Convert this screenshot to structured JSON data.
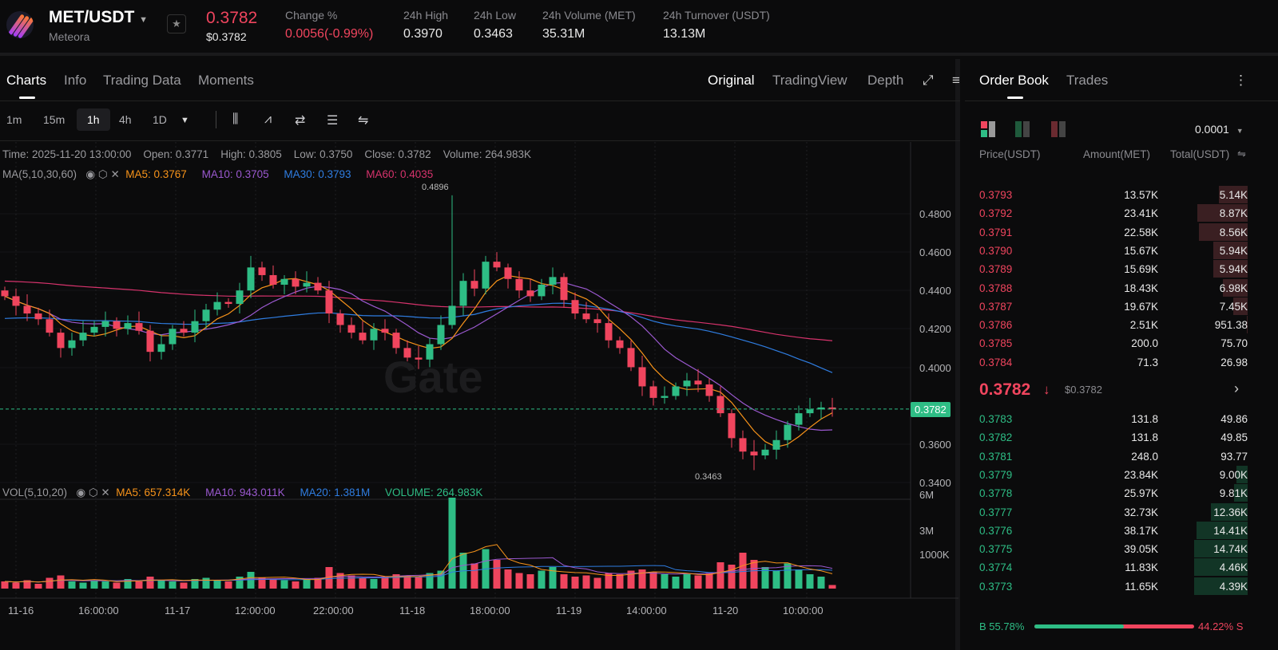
{
  "header": {
    "pair": "MET/USDT",
    "name": "Meteora",
    "price": "0.3782",
    "price_usd": "$0.3782",
    "stats": [
      {
        "label": "Change %",
        "value": "0.0056(-0.99%)"
      },
      {
        "label": "24h High",
        "value": "0.3970"
      },
      {
        "label": "24h Low",
        "value": "0.3463"
      },
      {
        "label": "24h Volume (MET)",
        "value": "35.31M"
      },
      {
        "label": "24h Turnover (USDT)",
        "value": "13.13M"
      }
    ]
  },
  "tabs": [
    "Charts",
    "Info",
    "Trading Data",
    "Moments"
  ],
  "views": [
    "Original",
    "TradingView",
    "Depth"
  ],
  "timeframes": [
    "1m",
    "15m",
    "1h",
    "4h",
    "1D"
  ],
  "ohlc": {
    "time": "Time: 2025-11-20 13:00:00",
    "open": "Open: 0.3771",
    "high": "High: 0.3805",
    "low": "Low: 0.3750",
    "close": "Close: 0.3782",
    "volume": "Volume: 264.983K"
  },
  "ma": {
    "label": "MA(5,10,30,60)",
    "ma5": "MA5: 0.3767",
    "ma10": "MA10: 0.3705",
    "ma30": "MA30: 0.3793",
    "ma60": "MA60: 0.4035"
  },
  "vol": {
    "label": "VOL(5,10,20)",
    "ma5": "MA5: 657.314K",
    "ma10": "MA10: 943.011K",
    "ma20": "MA20: 1.381M",
    "volume": "VOLUME: 264.983K"
  },
  "watermark": "Gate",
  "price_axis": [
    "0.4800",
    "0.4600",
    "0.4400",
    "0.4200",
    "0.4000",
    "0.3600",
    "0.3400"
  ],
  "vol_axis": [
    "6M",
    "3M",
    "1000K"
  ],
  "time_axis": [
    "11-16",
    "16:00:00",
    "11-17",
    "12:00:00",
    "22:00:00",
    "11-18",
    "18:00:00",
    "11-19",
    "14:00:00",
    "11-20",
    "10:00:00"
  ],
  "current_price_tag": "0.3782",
  "high_marker": "0.4896",
  "low_marker": "0.3463",
  "colors": {
    "up": "#2ebd85",
    "down": "#f0455e",
    "ma5": "#f7931a",
    "ma10": "#9b59d0",
    "ma30": "#2f7de1",
    "ma60": "#d6336c"
  },
  "chart_data": {
    "type": "candlestick",
    "price_range": [
      0.334,
      0.492
    ],
    "closes": [
      0.437,
      0.432,
      0.428,
      0.425,
      0.418,
      0.41,
      0.414,
      0.418,
      0.421,
      0.424,
      0.42,
      0.423,
      0.419,
      0.408,
      0.412,
      0.42,
      0.418,
      0.424,
      0.43,
      0.434,
      0.433,
      0.44,
      0.452,
      0.448,
      0.443,
      0.446,
      0.442,
      0.444,
      0.44,
      0.428,
      0.422,
      0.418,
      0.414,
      0.42,
      0.418,
      0.41,
      0.405,
      0.404,
      0.412,
      0.422,
      0.432,
      0.445,
      0.441,
      0.455,
      0.452,
      0.446,
      0.44,
      0.437,
      0.443,
      0.447,
      0.435,
      0.428,
      0.425,
      0.423,
      0.414,
      0.41,
      0.4,
      0.39,
      0.384,
      0.385,
      0.39,
      0.393,
      0.391,
      0.385,
      0.376,
      0.363,
      0.356,
      0.354,
      0.357,
      0.362,
      0.37,
      0.376,
      0.378,
      0.379,
      0.3782
    ],
    "volumes_m": [
      0.6,
      0.5,
      0.7,
      0.4,
      0.9,
      1.1,
      0.6,
      0.5,
      0.7,
      0.6,
      0.5,
      0.8,
      0.6,
      1.0,
      0.7,
      0.6,
      0.5,
      0.8,
      0.9,
      0.7,
      0.6,
      1.0,
      1.4,
      0.9,
      0.8,
      0.7,
      0.6,
      0.8,
      0.9,
      1.8,
      1.3,
      1.1,
      0.9,
      0.8,
      1.0,
      1.2,
      1.1,
      1.0,
      1.3,
      1.5,
      7.6,
      3.0,
      2.1,
      3.3,
      2.4,
      1.6,
      1.3,
      1.2,
      1.5,
      1.8,
      1.2,
      1.0,
      1.1,
      0.9,
      1.3,
      1.2,
      1.5,
      1.6,
      1.4,
      1.2,
      1.0,
      1.2,
      1.1,
      1.3,
      2.2,
      2.0,
      3.0,
      2.4,
      1.8,
      1.5,
      2.1,
      1.6,
      1.2,
      1.0,
      0.3
    ],
    "spike": {
      "index": 40,
      "high": 0.4896
    },
    "low_point": {
      "index": 67,
      "low": 0.3463
    }
  },
  "orderbook": {
    "tabs": [
      "Order Book",
      "Trades"
    ],
    "precision": "0.0001",
    "cols": [
      "Price(USDT)",
      "Amount(MET)",
      "Total(USDT)"
    ],
    "asks": [
      [
        "0.3793",
        "13.57K",
        "5.14K",
        0.35
      ],
      [
        "0.3792",
        "23.41K",
        "8.87K",
        0.61
      ],
      [
        "0.3791",
        "22.58K",
        "8.56K",
        0.59
      ],
      [
        "0.3790",
        "15.67K",
        "5.94K",
        0.41
      ],
      [
        "0.3789",
        "15.69K",
        "5.94K",
        0.41
      ],
      [
        "0.3788",
        "18.43K",
        "6.98K",
        0.3
      ],
      [
        "0.3787",
        "19.67K",
        "7.45K",
        0.17
      ],
      [
        "0.3786",
        "2.51K",
        "951.38",
        0.01
      ],
      [
        "0.3785",
        "200.0",
        "75.70",
        0
      ],
      [
        "0.3784",
        "71.3",
        "26.98",
        0
      ]
    ],
    "last": "0.3782",
    "last_arrow": "↓",
    "last_usd": "$0.3782",
    "bids": [
      [
        "0.3783",
        "131.8",
        "49.86",
        0
      ],
      [
        "0.3782",
        "131.8",
        "49.85",
        0
      ],
      [
        "0.3781",
        "248.0",
        "93.77",
        0
      ],
      [
        "0.3779",
        "23.84K",
        "9.00K",
        0.13
      ],
      [
        "0.3778",
        "25.97K",
        "9.81K",
        0.16
      ],
      [
        "0.3777",
        "32.73K",
        "12.36K",
        0.44
      ],
      [
        "0.3776",
        "38.17K",
        "14.41K",
        0.62
      ],
      [
        "0.3775",
        "39.05K",
        "14.74K",
        0.64
      ],
      [
        "0.3774",
        "11.83K",
        "4.46K",
        0.64
      ],
      [
        "0.3773",
        "11.65K",
        "4.39K",
        0.64
      ]
    ],
    "buy_pct": "B 55.78%",
    "sell_pct": "44.22% S",
    "buy_ratio": 0.5578
  }
}
